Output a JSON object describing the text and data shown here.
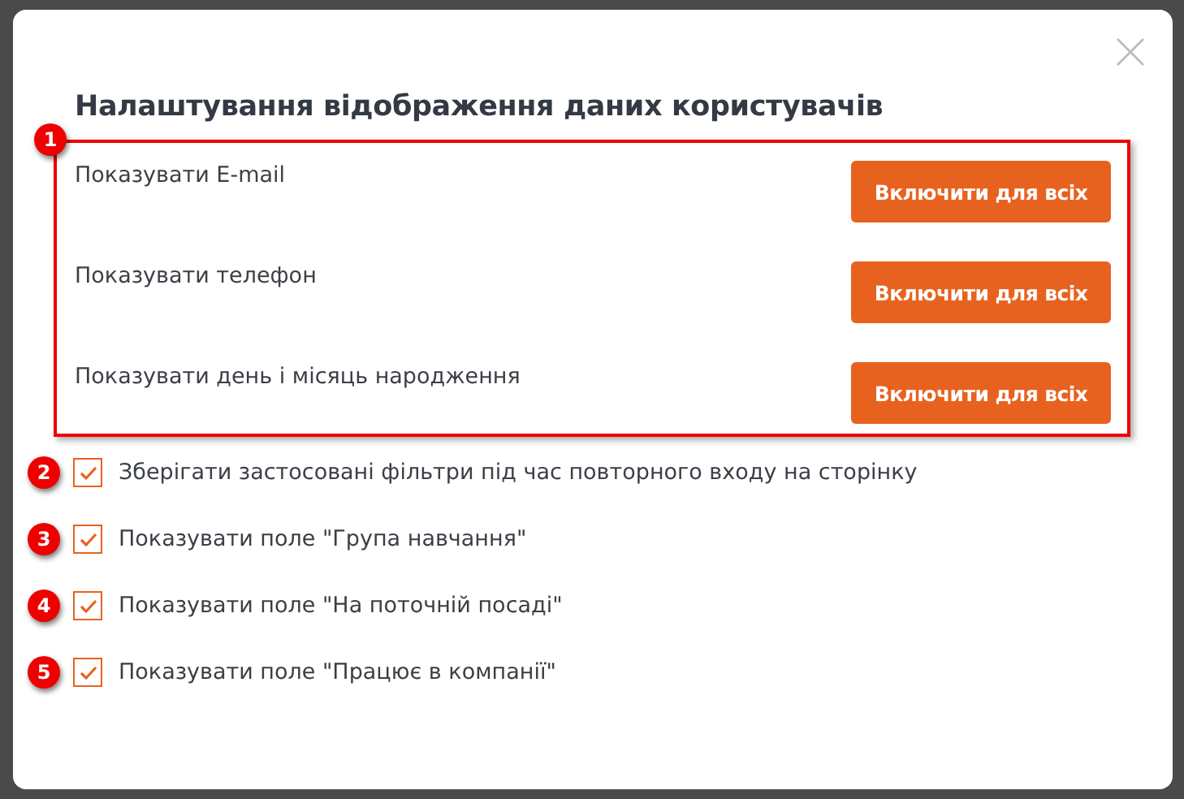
{
  "dialog": {
    "title": "Налаштування відображення даних користувачів"
  },
  "field_group": {
    "marker": "1",
    "rows": [
      {
        "label": "Показувати E-mail",
        "button": "Включити для всіх"
      },
      {
        "label": "Показувати телефон",
        "button": "Включити для всіх"
      },
      {
        "label": "Показувати день і місяць народження",
        "button": "Включити для всіх"
      }
    ]
  },
  "options": [
    {
      "marker": "2",
      "label": "Зберігати застосовані фільтри під час повторного входу на сторінку",
      "checked": true
    },
    {
      "marker": "3",
      "label": "Показувати поле \"Група навчання\"",
      "checked": true
    },
    {
      "marker": "4",
      "label": "Показувати поле \"На поточній посаді\"",
      "checked": true
    },
    {
      "marker": "5",
      "label": "Показувати поле \"Працює в компанії\"",
      "checked": true
    }
  ]
}
